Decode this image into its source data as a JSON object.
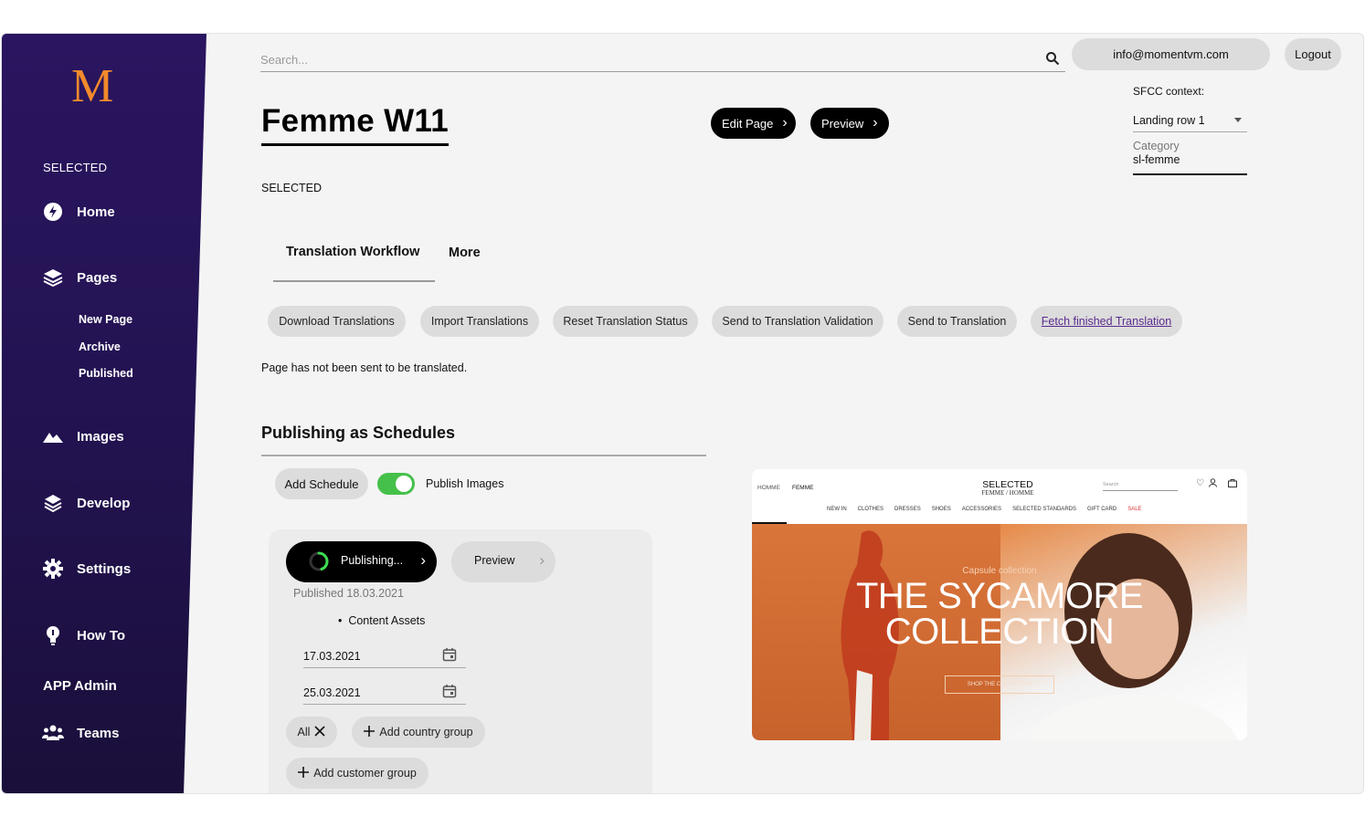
{
  "sidebar": {
    "logo": "M",
    "section_label": "SELECTED",
    "items": [
      {
        "label": "Home",
        "icon": "bolt-icon"
      },
      {
        "label": "Pages",
        "icon": "layers-icon"
      },
      {
        "label": "Images",
        "icon": "mountain-icon"
      },
      {
        "label": "Develop",
        "icon": "stack-icon"
      },
      {
        "label": "Settings",
        "icon": "gear-icon"
      },
      {
        "label": "How To",
        "icon": "lightbulb-icon"
      },
      {
        "label": "Teams",
        "icon": "team-icon"
      }
    ],
    "pages_sub": [
      "New Page",
      "Archive",
      "Published"
    ],
    "app_admin": "APP Admin"
  },
  "header": {
    "search_placeholder": "Search...",
    "email": "info@momentvm.com",
    "logout": "Logout"
  },
  "page": {
    "title": "Femme W11",
    "edit_page": "Edit Page",
    "preview": "Preview",
    "brand": "SELECTED"
  },
  "sfcc": {
    "label": "SFCC context:",
    "selected": "Landing row 1",
    "category_label": "Category",
    "category_value": "sl-femme"
  },
  "tabs": {
    "active": "Translation Workflow",
    "more": "More"
  },
  "translation_actions": [
    "Download Translations",
    "Import Translations",
    "Reset Translation Status",
    "Send to Translation Validation",
    "Send to Translation",
    "Fetch finished Translation"
  ],
  "translation_status": "Page has not been sent to be translated.",
  "publishing": {
    "heading": "Publishing as Schedules",
    "add_schedule": "Add Schedule",
    "publish_images_label": "Publish Images",
    "publish_images_on": true,
    "publishing_button": "Publishing...",
    "preview_button": "Preview",
    "published_date": "Published 18.03.2021",
    "bullet": "Content Assets",
    "start_date": "17.03.2021",
    "end_date": "25.03.2021",
    "all_chip": "All",
    "add_country_group": "Add country group",
    "add_customer_group": "Add customer group"
  },
  "site_preview": {
    "left_links": [
      "HOMME",
      "FEMME"
    ],
    "brand": "SELECTED",
    "brand_sub": "FEMME / HOMME",
    "search": "Search",
    "nav": [
      "NEW IN",
      "CLOTHES",
      "DRESSES",
      "SHOES",
      "ACCESSORIES",
      "SELECTED STANDARDS",
      "GIFT CARD",
      "SALE"
    ],
    "capsule": "Capsule collection",
    "headline_1": "THE SYCAMORE",
    "headline_2": "COLLECTION",
    "cta": "SHOP THE COLLECTION"
  },
  "colors": {
    "sidebar": "#241353",
    "accent": "#f28a2b",
    "toggle_on": "#45c04a",
    "link": "#5b2c8f"
  }
}
